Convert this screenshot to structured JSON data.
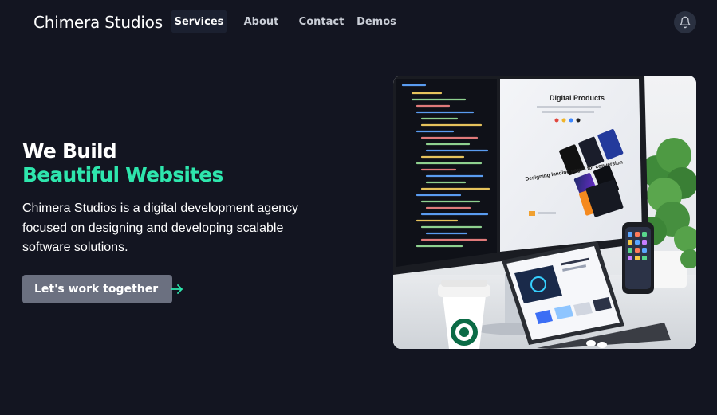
{
  "brand": {
    "name": "Chimera Studios"
  },
  "nav": {
    "items": [
      {
        "label": "Services",
        "active": true
      },
      {
        "label": "About"
      },
      {
        "label": "Contact"
      },
      {
        "label": "Demos"
      }
    ],
    "notification_icon": "bell-icon"
  },
  "hero": {
    "heading_line1": "We Build",
    "heading_line2": "Beautiful Websites",
    "description": "Chimera Studios is a digital development agency focused on designing and developing scalable software solutions.",
    "cta_label": "Let's work together",
    "cta_icon": "arrow-right-icon",
    "image": {
      "monitor_title": "Digital Products",
      "monitor_subtitle": "Designing landing pages for conversion"
    }
  },
  "colors": {
    "background": "#131521",
    "accent": "#2ee6ad",
    "button": "#6b7080",
    "nav_active_bg": "#1b2030"
  }
}
